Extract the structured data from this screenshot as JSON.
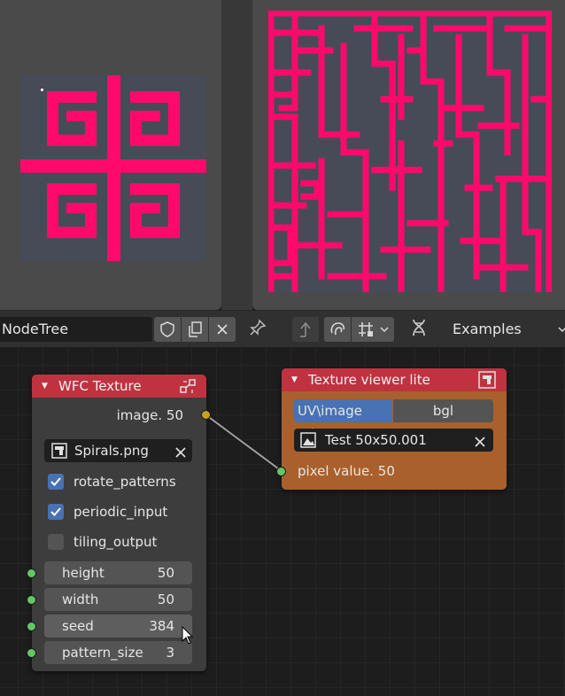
{
  "header": {
    "tree_name": "NodeTree",
    "examples_label": "Examples",
    "buttons": [
      "shield-icon",
      "copy-icon",
      "close-icon",
      "pin-icon",
      "parent-node-icon",
      "snap-icon",
      "grid-snap-icon",
      "dna-icon"
    ]
  },
  "wfc_node": {
    "title": "WFC Texture",
    "output_label": "image. 50",
    "image_name": "Spirals.png",
    "rotate_patterns_label": "rotate_patterns",
    "rotate_patterns": true,
    "periodic_input_label": "periodic_input",
    "periodic_input": true,
    "tiling_output_label": "tiling_output",
    "tiling_output": false,
    "height_label": "height",
    "height_value": "50",
    "width_label": "width",
    "width_value": "50",
    "seed_label": "seed",
    "seed_value": "384",
    "pattern_size_label": "pattern_size",
    "pattern_size_value": "3"
  },
  "viewer_node": {
    "title": "Texture viewer lite",
    "mode_options": [
      "UV\\image ed...",
      "bgl"
    ],
    "mode_selected": "UV\\image ed...",
    "mode_option_1": "UV\\image ed...",
    "mode_option_2": "bgl",
    "image_name": "Test 50x50.001",
    "input_label": "pixel value. 50"
  },
  "colors": {
    "accent_pink": "#ff0a6c",
    "texture_bg": "#464b57",
    "node_header_red": "#c03240",
    "viewer_body_orange": "#a9602c",
    "socket_green": "#63c763",
    "socket_yellow": "#c7a01f",
    "checkbox_blue": "#4772b3"
  }
}
